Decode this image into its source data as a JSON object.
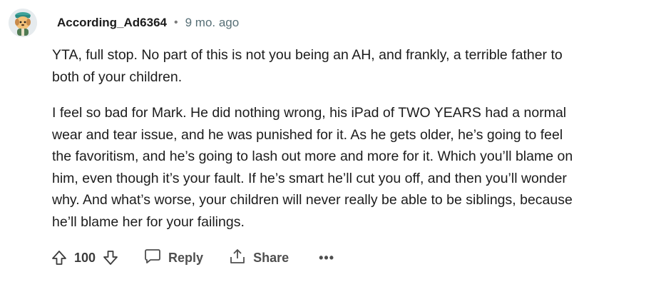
{
  "comment": {
    "author": "According_Ad6364",
    "separator": "•",
    "time_ago": "9 mo. ago",
    "paragraphs": [
      "YTA, full stop. No part of this is not you being an AH, and frankly, a terrible father to\nboth of your children.",
      "I feel so bad for Mark. He did nothing wrong, his iPad of TWO YEARS had a normal\nwear and tear issue, and he was punished for it. As he gets older, he’s going to feel\nthe favoritism, and he’s going to lash out more and more for it. Which you’ll blame on\nhim, even though it’s your fault. If he’s smart he’ll cut you off, and then you’ll wonder\nwhy. And what’s worse, your children will never really be able to be siblings, because\nhe’ll blame her for your failings."
    ],
    "actions": {
      "score": "100",
      "reply_label": "Reply",
      "share_label": "Share",
      "more_label": "•••"
    },
    "icons": {
      "avatar": "snoo-avatar-icon",
      "upvote": "upvote-arrow-icon",
      "downvote": "downvote-arrow-icon",
      "reply": "speech-bubble-icon",
      "share": "share-icon"
    }
  }
}
